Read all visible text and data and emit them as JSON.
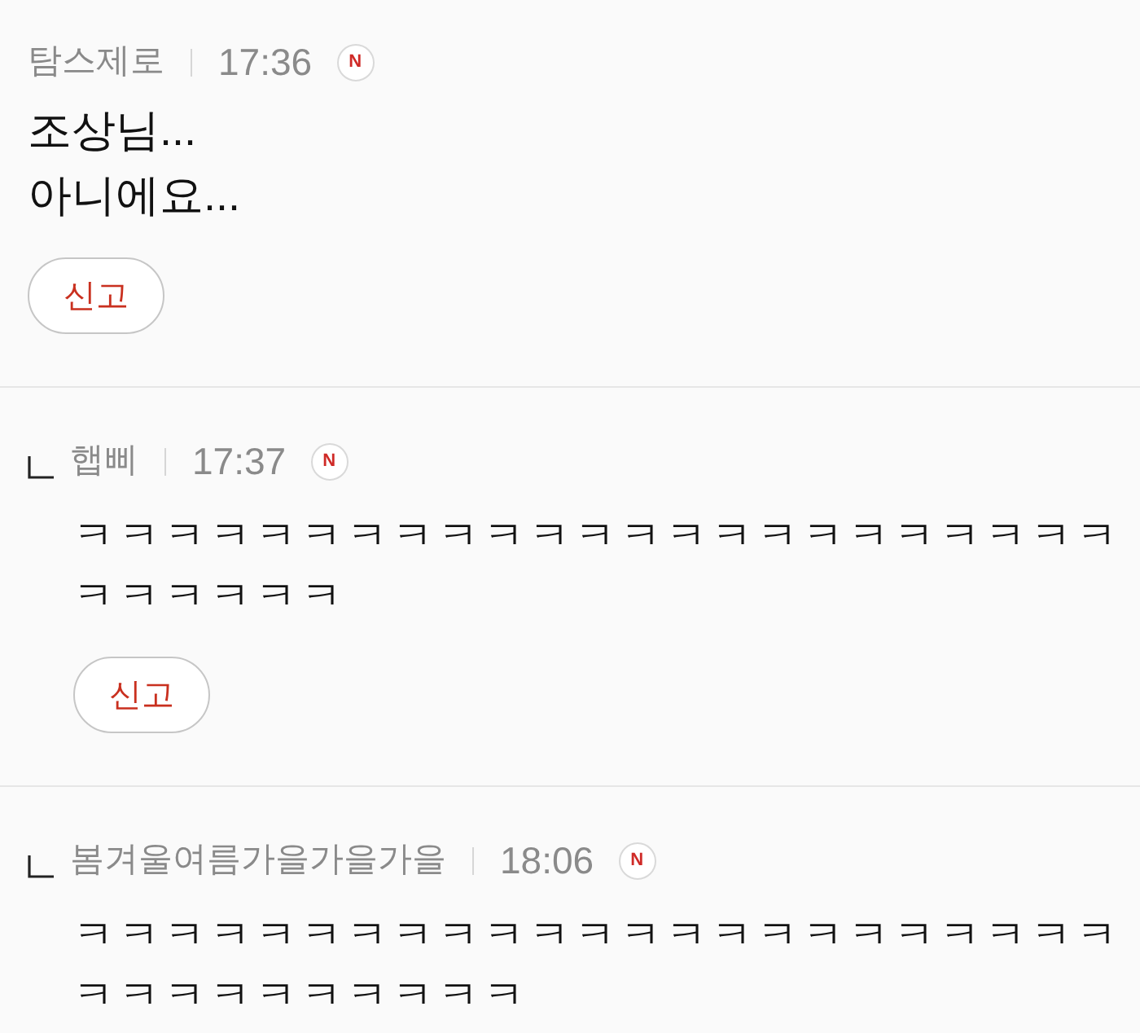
{
  "comments": [
    {
      "kind": "comment",
      "author": "탐스제로",
      "time": "17:36",
      "badge": "N",
      "text": "조상님...\n아니에요...",
      "report_button": "신고"
    },
    {
      "kind": "reply",
      "author": "햅삐",
      "time": "17:37",
      "badge": "N",
      "text": "ㅋㅋㅋㅋㅋㅋㅋㅋㅋㅋㅋㅋㅋㅋㅋㅋㅋㅋㅋㅋㅋㅋㅋㅋㅋㅋㅋㅋㅋ",
      "report_button": "신고"
    },
    {
      "kind": "reply",
      "author": "봄겨울여름가을가을가을",
      "time": "18:06",
      "badge": "N",
      "text": "ㅋㅋㅋㅋㅋㅋㅋㅋㅋㅋㅋㅋㅋㅋㅋㅋㅋㅋㅋㅋㅋㅋㅋㅋㅋㅋㅋㅋㅋㅋㅋㅋㅋ"
    }
  ]
}
